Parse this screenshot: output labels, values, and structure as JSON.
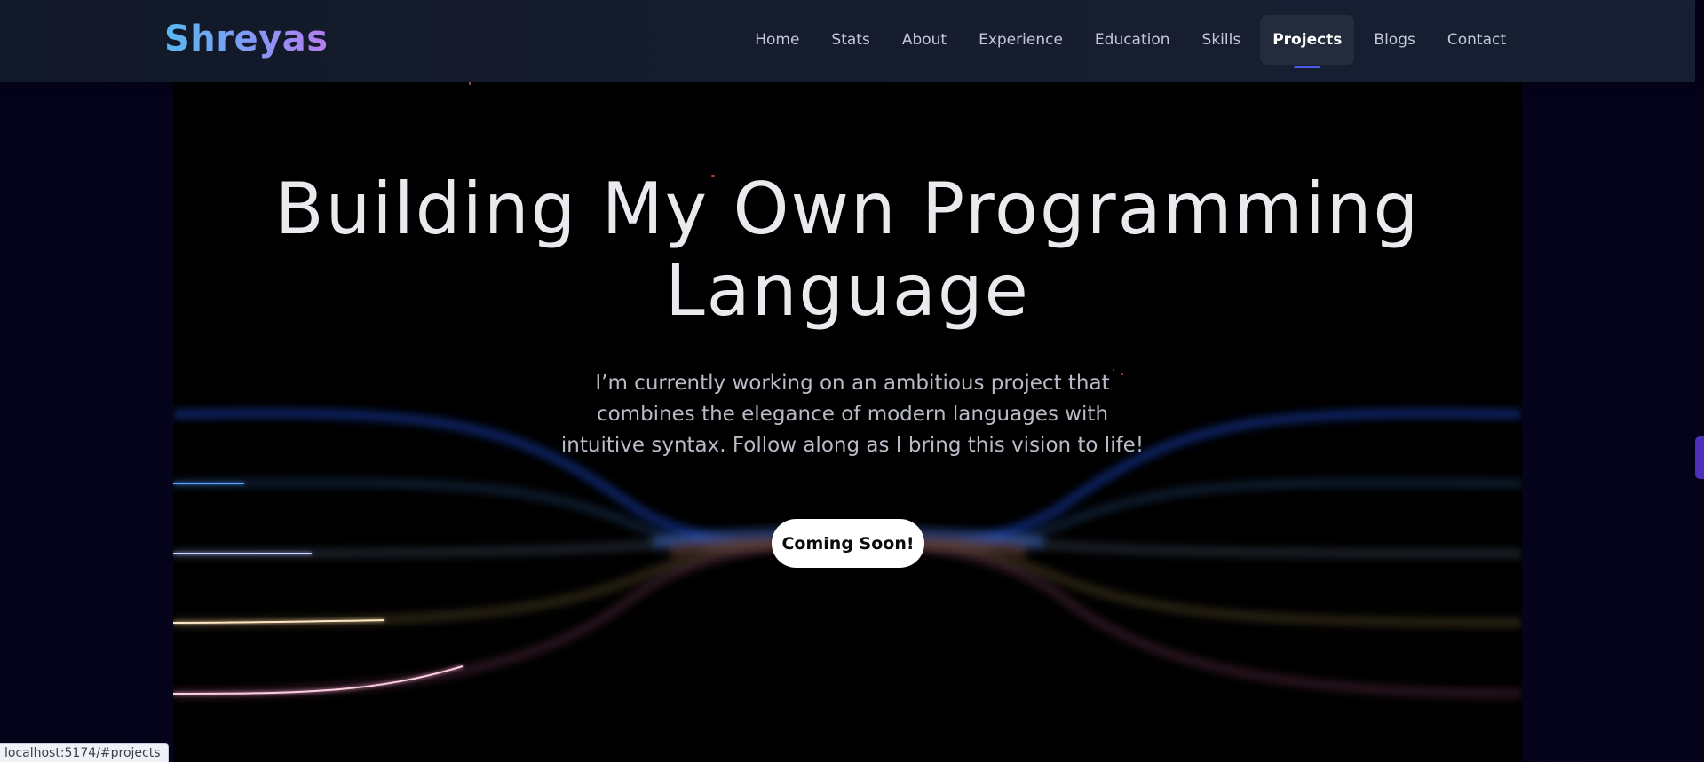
{
  "header": {
    "logo": "Shreyas",
    "nav": [
      {
        "label": "Home",
        "active": false
      },
      {
        "label": "Stats",
        "active": false
      },
      {
        "label": "About",
        "active": false
      },
      {
        "label": "Experience",
        "active": false
      },
      {
        "label": "Education",
        "active": false
      },
      {
        "label": "Skills",
        "active": false
      },
      {
        "label": "Projects",
        "active": true
      },
      {
        "label": "Blogs",
        "active": false
      },
      {
        "label": "Contact",
        "active": false
      }
    ]
  },
  "hero": {
    "title_line1": "Building My Own Programming",
    "title_line2": "Language",
    "subtitle": "I’m currently working on an ambitious project that combines the elegance of modern languages with intuitive syntax. Follow along as I bring this vision to life!",
    "cta_label": "Coming Soon!"
  },
  "status_bar": {
    "url": "localhost:5174/#projects"
  },
  "colors": {
    "accent_indigo": "#4b57e8",
    "logo_gradient_start": "#58b9f0",
    "logo_gradient_end": "#b87cf0",
    "wave_blue": "#3b82f6",
    "wave_lightblue": "#a5b4fc",
    "wave_peach": "#fcd9a8",
    "wave_pink": "#f9a8c9"
  }
}
